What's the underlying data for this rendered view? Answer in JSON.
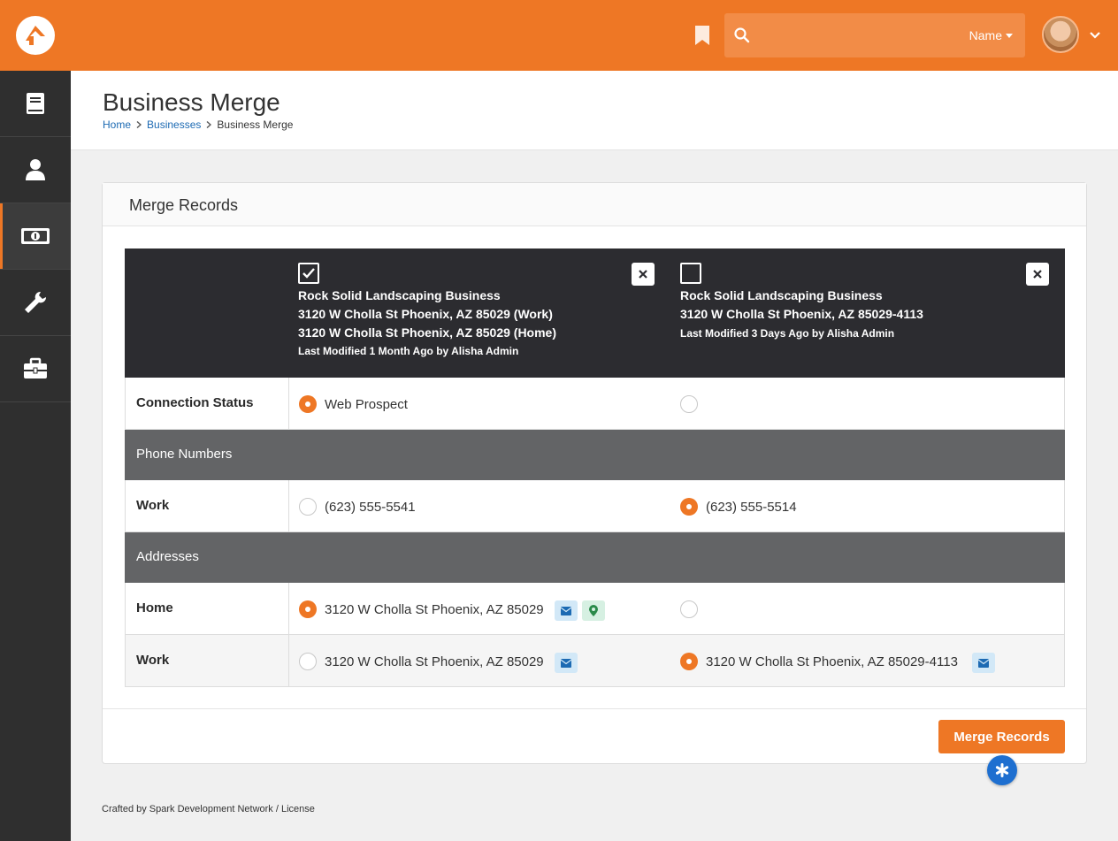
{
  "header": {
    "search_placeholder": "",
    "search_type": "Name"
  },
  "sidebar": {
    "items": [
      {
        "icon": "book-icon"
      },
      {
        "icon": "person-icon"
      },
      {
        "icon": "money-icon",
        "active": true
      },
      {
        "icon": "wrench-icon"
      },
      {
        "icon": "briefcase-icon"
      }
    ]
  },
  "page": {
    "title": "Business Merge",
    "breadcrumb": [
      "Home",
      "Businesses",
      "Business Merge"
    ]
  },
  "panel": {
    "title": "Merge Records"
  },
  "records": [
    {
      "checked": true,
      "name": "Rock Solid Landscaping Business",
      "lines": [
        "3120 W Cholla St Phoenix, AZ 85029 (Work)",
        "3120 W Cholla St Phoenix, AZ 85029 (Home)"
      ],
      "modified": "Last Modified 1 Month Ago by Alisha Admin"
    },
    {
      "checked": false,
      "name": "Rock Solid Landscaping Business",
      "lines": [
        "3120 W Cholla St Phoenix, AZ 85029-4113"
      ],
      "modified": "Last Modified 3 Days Ago by Alisha Admin"
    }
  ],
  "rows": {
    "connection_status": {
      "label": "Connection Status",
      "values": [
        "Web Prospect",
        ""
      ],
      "selected": 0
    },
    "phone_section": "Phone Numbers",
    "phone_work": {
      "label": "Work",
      "values": [
        "(623) 555-5541",
        "(623) 555-5514"
      ],
      "selected": 1
    },
    "address_section": "Addresses",
    "address_home": {
      "label": "Home",
      "values": [
        "3120 W Cholla St Phoenix, AZ 85029",
        ""
      ],
      "selected": 0
    },
    "address_work": {
      "label": "Work",
      "values": [
        "3120 W Cholla St Phoenix, AZ 85029",
        "3120 W Cholla St Phoenix, AZ 85029-4113"
      ],
      "selected": 1
    }
  },
  "actions": {
    "merge_label": "Merge Records"
  },
  "footer": {
    "text": "Crafted by Spark Development Network / License"
  },
  "colors": {
    "accent": "#ee7725",
    "header_dark": "#2c2c30",
    "section_gray": "#636466",
    "link": "#1c6ab3"
  }
}
